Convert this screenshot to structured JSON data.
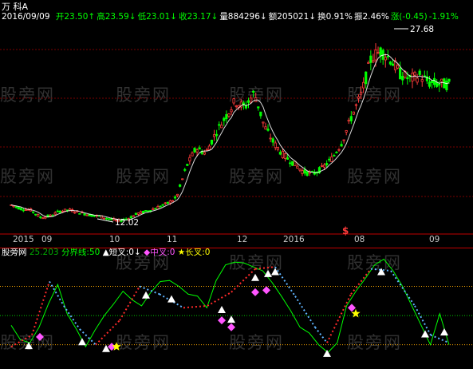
{
  "header": {
    "stock_name": "万 科A",
    "date": "2016/09/09",
    "fields": [
      {
        "label": "开",
        "value": "23.50",
        "arrow": "↑",
        "color": "#00ff00"
      },
      {
        "label": "高",
        "value": "23.59",
        "arrow": "↓",
        "color": "#00ff00"
      },
      {
        "label": "低",
        "value": "23.01",
        "arrow": "↓",
        "color": "#00ff00"
      },
      {
        "label": "收",
        "value": "23.17",
        "arrow": "↓",
        "color": "#00ff00"
      },
      {
        "label": "量",
        "value": "884296",
        "arrow": "↓",
        "color": "#ffffff"
      },
      {
        "label": "额",
        "value": "205021",
        "arrow": "↓",
        "color": "#ffffff"
      },
      {
        "label": "换",
        "value": "0.91%",
        "arrow": "",
        "color": "#ffffff"
      },
      {
        "label": "振",
        "value": "2.46%",
        "arrow": "",
        "color": "#ffffff"
      },
      {
        "label": "涨",
        "value": "(-0.45)",
        "arrow": "",
        "color": "#00ff00"
      },
      {
        "label": "",
        "value": "-1.91%",
        "arrow": "",
        "color": "#00ff00"
      }
    ]
  },
  "price_labels": {
    "high": "27.68",
    "low": "12.02"
  },
  "x_axis": {
    "labels": [
      "2015",
      "09",
      "10",
      "11",
      "12",
      "2016",
      "08",
      "09"
    ]
  },
  "event_marker": "$",
  "indicator_legend": {
    "name": "股旁网",
    "value_label": "25.203",
    "boundary": "分界线:50",
    "items": [
      {
        "symbol": "▲",
        "text": "短叉:0",
        "arrow": "↓",
        "color": "#ffffff"
      },
      {
        "symbol": "◆",
        "text": "中叉:0",
        "arrow": "",
        "color": "#ff55ff"
      },
      {
        "symbol": "★",
        "text": "长叉:0",
        "arrow": "",
        "color": "#ffff00"
      }
    ]
  },
  "watermark": "股旁网",
  "colors": {
    "up": "#ff3b3b",
    "down": "#00ff00",
    "ma": "#ffffff",
    "grid": "#7a0000",
    "axis_text": "#c8c8c8",
    "indicator_line": "#00ff00",
    "indicator_up": "#ff2a2a",
    "indicator_down": "#5fb4ff",
    "short_marker": "#ffffff",
    "mid_marker": "#ff55ff",
    "long_marker": "#ffff00"
  },
  "chart_data": [
    {
      "type": "candlestick",
      "title": "",
      "series": [
        {
          "values": [
            13.4,
            13.1,
            13.0,
            12.4,
            12.5,
            12.9,
            13.0,
            12.8,
            12.6,
            12.5,
            12.3,
            12.1,
            12.3,
            12.7,
            12.9,
            13.2,
            13.5,
            14.0,
            16.5,
            18.0,
            17.6,
            19.2,
            20.5,
            21.8,
            21.3,
            22.5,
            19.8,
            18.4,
            17.4,
            16.8,
            16.1,
            15.9,
            16.4,
            17.2,
            18.5,
            20.6,
            22.4,
            25.3,
            25.9,
            25.2,
            24.0,
            23.6,
            23.9,
            23.3,
            23.2,
            23.17
          ]
        }
      ],
      "annotations": [
        "27.68",
        "12.02"
      ]
    },
    {
      "type": "line",
      "title": "",
      "boundary": 50,
      "series": [
        {
          "values": [
            40,
            25,
            22,
            38,
            62,
            82,
            52,
            36,
            18,
            35,
            50,
            62,
            75,
            66,
            60,
            74,
            85,
            86,
            80,
            72,
            70,
            58,
            86,
            102,
            105,
            104,
            100,
            96,
            84,
            70,
            55,
            38,
            32,
            20,
            12,
            22,
            60,
            75,
            88,
            102,
            108,
            96,
            80,
            60,
            40,
            20,
            52,
            20
          ]
        }
      ]
    }
  ]
}
